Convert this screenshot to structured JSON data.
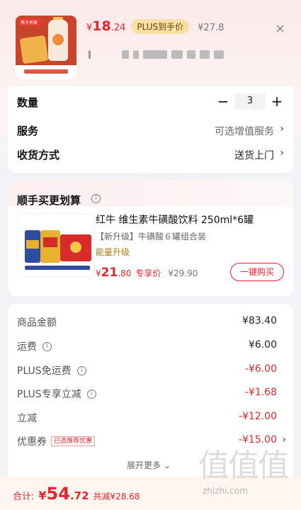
{
  "header": {
    "price_symbol": "¥",
    "price_int": "18",
    "price_dec": ".24",
    "plus_badge": "PLUS到手价",
    "orig_price": "¥27.8",
    "close_icon": "×",
    "thumb_tag": "熊大有家"
  },
  "order": {
    "qty_label": "数量",
    "qty_value": "3",
    "minus": "−",
    "plus": "+",
    "service_label": "服务",
    "service_value": "可选增值服务",
    "delivery_label": "收货方式",
    "delivery_value": "送货上门",
    "chevron": "›"
  },
  "bundle": {
    "title": "顺手买更划算",
    "info": "i",
    "name": "红牛 维生素牛磺酸饮料 250ml*6罐",
    "subtitle": "【新升级】牛磺酸６罐组合装",
    "tag": "能量升级",
    "price_symbol": "¥",
    "price_int": "21",
    "price_dec": ".80",
    "price_label": "专享价",
    "orig_price": "¥29.90",
    "buy_button": "一键购买"
  },
  "fees": {
    "rows": [
      {
        "label": "商品金额",
        "value": "¥83.40"
      },
      {
        "label": "运费",
        "value": "¥6.00"
      },
      {
        "label": "PLUS免运费",
        "value": "-¥6.00"
      },
      {
        "label": "PLUS专享立减",
        "value": "-¥1.68"
      },
      {
        "label": "立减",
        "value": "-¥12.00"
      },
      {
        "label": "优惠券",
        "value": "-¥15.00"
      }
    ],
    "coupon_chip": "已选推荐优惠",
    "info": "i",
    "chevron": "›",
    "more": "展开更多 ⌄"
  },
  "footer": {
    "total_label": "合计:",
    "price_symbol": "¥",
    "total_int": "54",
    "total_dec": ".72",
    "saved": "共减¥28.68"
  },
  "watermark": {
    "glyphs": "值值值",
    "url": "zhizhi.com"
  },
  "colors": {
    "accent": "#e4262c",
    "plus_gold": "#f8e0a3",
    "background": "#f3f2f7"
  }
}
